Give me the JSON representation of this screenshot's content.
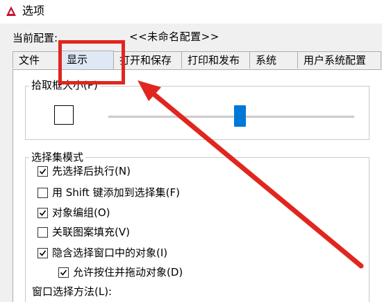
{
  "window": {
    "title": "选项",
    "app_icon": "autocad-icon",
    "brand_color": "#c8102e"
  },
  "profile": {
    "label": "当前配置:",
    "value": "<<未命名配置>>"
  },
  "tabs": [
    {
      "label": "文件",
      "active": false
    },
    {
      "label": "显示",
      "active": true
    },
    {
      "label": "打开和保存",
      "active": false
    },
    {
      "label": "打印和发布",
      "active": false
    },
    {
      "label": "系统",
      "active": false
    },
    {
      "label": "用户系统配置",
      "active": false
    }
  ],
  "pickbox": {
    "title": "拾取框大小(P)"
  },
  "selection_modes": {
    "title": "选择集模式",
    "items": [
      {
        "label": "先选择后执行(N)",
        "checked": true
      },
      {
        "label": "用 Shift 键添加到选择集(F)",
        "checked": false
      },
      {
        "label": "对象编组(O)",
        "checked": true
      },
      {
        "label": "关联图案填充(V)",
        "checked": false
      },
      {
        "label": "隐含选择窗口中的对象(I)",
        "checked": true
      },
      {
        "label": "允许按住并拖动对象(D)",
        "checked": true
      }
    ],
    "window_method_label": "窗口选择方法(L):"
  },
  "annotation": {
    "color": "#e0261f"
  }
}
